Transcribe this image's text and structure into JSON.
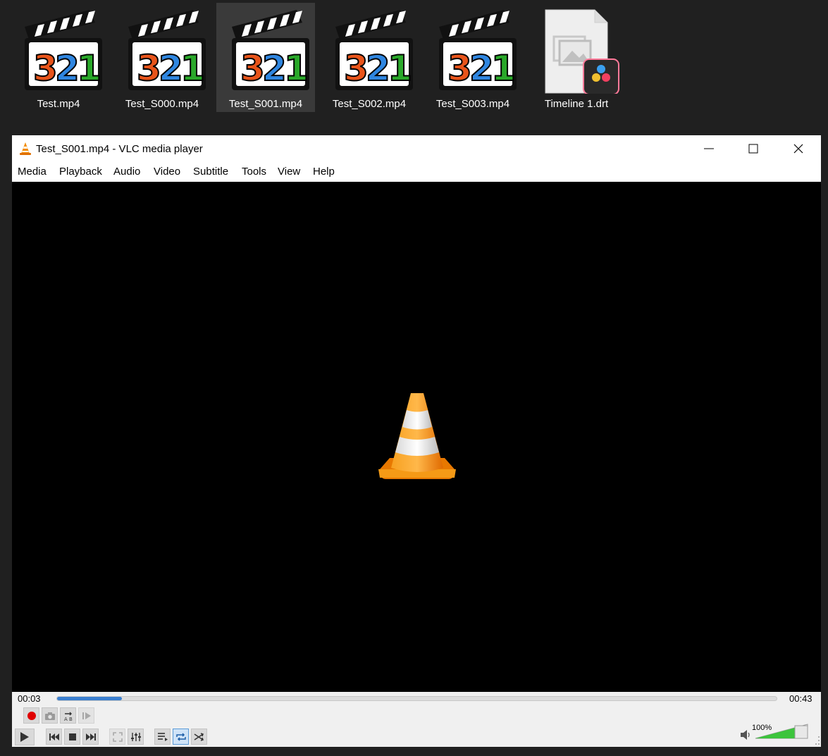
{
  "desktop": {
    "files": [
      {
        "name": "Test.mp4",
        "icon": "media-player-classic-321-icon"
      },
      {
        "name": "Test_S000.mp4",
        "icon": "media-player-classic-321-icon"
      },
      {
        "name": "Test_S001.mp4",
        "icon": "media-player-classic-321-icon",
        "selected": true
      },
      {
        "name": "Test_S002.mp4",
        "icon": "media-player-classic-321-icon"
      },
      {
        "name": "Test_S003.mp4",
        "icon": "media-player-classic-321-icon"
      },
      {
        "name": "Timeline 1.drt",
        "icon": "davinci-resolve-file-icon"
      }
    ],
    "thumb_digits": "321"
  },
  "window": {
    "title": "Test_S001.mp4 - VLC media player",
    "app_icon": "vlc-cone-icon",
    "controls": [
      "minimize-icon",
      "maximize-icon",
      "close-icon"
    ]
  },
  "menu": [
    "Media",
    "Playback",
    "Audio",
    "Video",
    "Subtitle",
    "Tools",
    "View",
    "Help"
  ],
  "player": {
    "elapsed": "00:03",
    "total": "00:43",
    "progress_fraction": 0.09,
    "volume_text": "100%",
    "volume_fraction": 1.0,
    "accent": "#3a7fd0",
    "volume_color": "#3cc43c",
    "record_color": "#e00000"
  }
}
